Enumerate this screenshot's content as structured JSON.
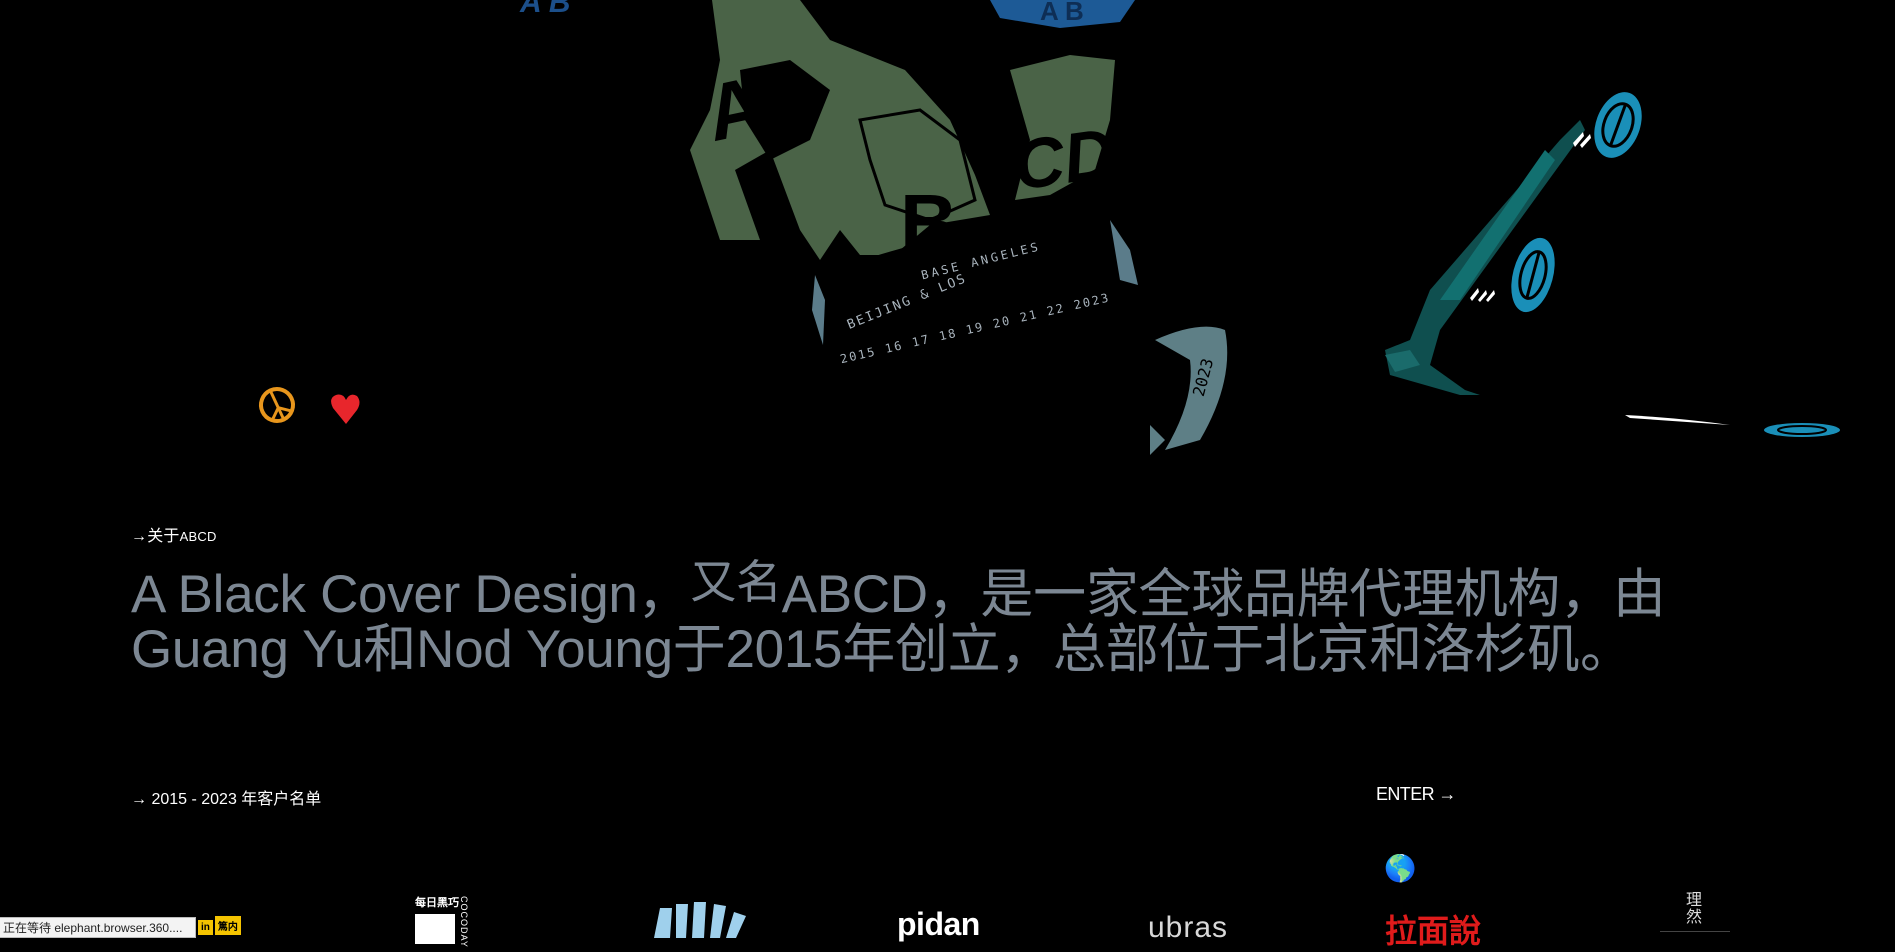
{
  "artwork": {
    "top_left_fragment": "A B",
    "top_fragment": "A B",
    "logo_letters_a": "A",
    "logo_letters_b": "B",
    "logo_letters_cd": "CD",
    "ribbon_line1": "BASE ANGELES",
    "ribbon_line2": "BEIJING & LOS",
    "ribbon_line3": "2015 16 17 18 19 20 21 22 2023",
    "small_shard_text": "2023"
  },
  "about": {
    "arrow": "→",
    "label_prefix": "关于",
    "label_brand": "ABCD",
    "headline_part1": "A Black Cover Design，",
    "headline_raised": "又名",
    "headline_part2": "ABCD，是一家全球品牌代理机构，由",
    "headline_line2": "Guang Yu和Nod Young于2015年创立，总部位于北京和洛杉矶。"
  },
  "clients": {
    "label": "→ 2015 - 2023 年客户名单",
    "enter_label": "ENTER →",
    "globe_icon": "🌎",
    "logos": {
      "yellow_a": "in",
      "yellow_b": "篤内",
      "meiri_title": "每日黑巧",
      "meiri_vertical": "COCODAY",
      "pidan": "pidan",
      "ubras": "ubras",
      "lamian": "拉面說",
      "liran": "理然"
    }
  },
  "status_bar": {
    "text": "正在等待 elephant.browser.360...."
  },
  "colors": {
    "background": "#000000",
    "headline": "#7c8793",
    "green": "#4a6347",
    "teal": "#0f4f4f",
    "cyan": "#1a8fb8",
    "peace": "#e8961c",
    "heart": "#e8262c"
  }
}
